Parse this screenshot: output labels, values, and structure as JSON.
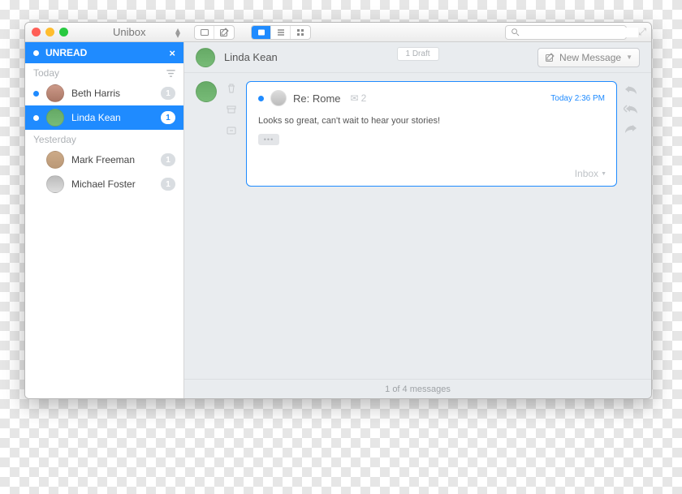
{
  "app": {
    "title": "Unibox"
  },
  "search": {
    "placeholder": ""
  },
  "sidebar": {
    "unread_label": "UNREAD",
    "sections": [
      {
        "label": "Today",
        "items": [
          {
            "name": "Beth Harris",
            "count": "1",
            "unread": true,
            "selected": false
          },
          {
            "name": "Linda Kean",
            "count": "1",
            "unread": true,
            "selected": true
          }
        ]
      },
      {
        "label": "Yesterday",
        "items": [
          {
            "name": "Mark Freeman",
            "count": "1",
            "unread": false,
            "selected": false
          },
          {
            "name": "Michael Foster",
            "count": "1",
            "unread": false,
            "selected": false
          }
        ]
      }
    ]
  },
  "conversation": {
    "name": "Linda Kean",
    "draft_label": "1 Draft",
    "new_message_label": "New Message",
    "message": {
      "subject": "Re: Rome",
      "thread_count": "2",
      "timestamp": "Today 2:36 PM",
      "body": "Looks so great, can't wait to hear your stories!",
      "folder_label": "Inbox"
    },
    "footer": "1 of 4 messages"
  }
}
